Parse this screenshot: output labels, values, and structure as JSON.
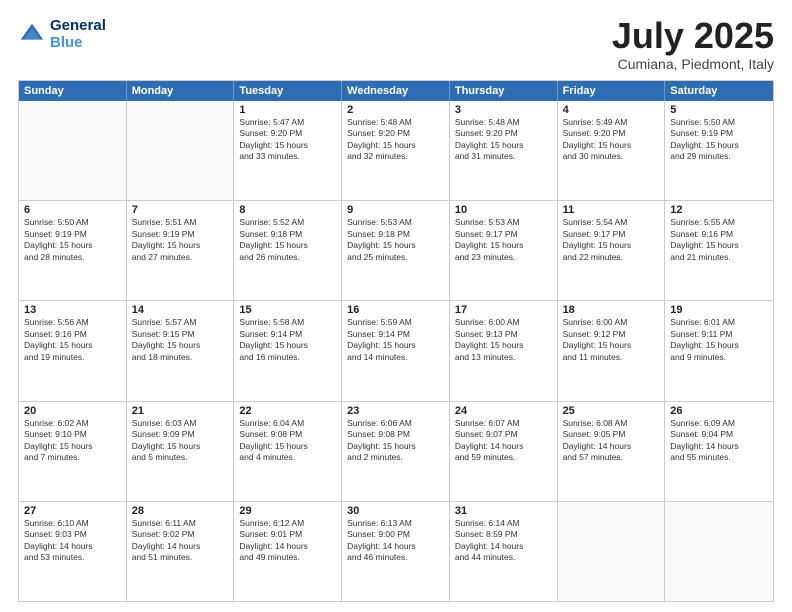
{
  "logo": {
    "line1": "General",
    "line2": "Blue"
  },
  "title": "July 2025",
  "subtitle": "Cumiana, Piedmont, Italy",
  "header_days": [
    "Sunday",
    "Monday",
    "Tuesday",
    "Wednesday",
    "Thursday",
    "Friday",
    "Saturday"
  ],
  "rows": [
    [
      {
        "day": "",
        "info": ""
      },
      {
        "day": "",
        "info": ""
      },
      {
        "day": "1",
        "info": "Sunrise: 5:47 AM\nSunset: 9:20 PM\nDaylight: 15 hours\nand 33 minutes."
      },
      {
        "day": "2",
        "info": "Sunrise: 5:48 AM\nSunset: 9:20 PM\nDaylight: 15 hours\nand 32 minutes."
      },
      {
        "day": "3",
        "info": "Sunrise: 5:48 AM\nSunset: 9:20 PM\nDaylight: 15 hours\nand 31 minutes."
      },
      {
        "day": "4",
        "info": "Sunrise: 5:49 AM\nSunset: 9:20 PM\nDaylight: 15 hours\nand 30 minutes."
      },
      {
        "day": "5",
        "info": "Sunrise: 5:50 AM\nSunset: 9:19 PM\nDaylight: 15 hours\nand 29 minutes."
      }
    ],
    [
      {
        "day": "6",
        "info": "Sunrise: 5:50 AM\nSunset: 9:19 PM\nDaylight: 15 hours\nand 28 minutes."
      },
      {
        "day": "7",
        "info": "Sunrise: 5:51 AM\nSunset: 9:19 PM\nDaylight: 15 hours\nand 27 minutes."
      },
      {
        "day": "8",
        "info": "Sunrise: 5:52 AM\nSunset: 9:18 PM\nDaylight: 15 hours\nand 26 minutes."
      },
      {
        "day": "9",
        "info": "Sunrise: 5:53 AM\nSunset: 9:18 PM\nDaylight: 15 hours\nand 25 minutes."
      },
      {
        "day": "10",
        "info": "Sunrise: 5:53 AM\nSunset: 9:17 PM\nDaylight: 15 hours\nand 23 minutes."
      },
      {
        "day": "11",
        "info": "Sunrise: 5:54 AM\nSunset: 9:17 PM\nDaylight: 15 hours\nand 22 minutes."
      },
      {
        "day": "12",
        "info": "Sunrise: 5:55 AM\nSunset: 9:16 PM\nDaylight: 15 hours\nand 21 minutes."
      }
    ],
    [
      {
        "day": "13",
        "info": "Sunrise: 5:56 AM\nSunset: 9:16 PM\nDaylight: 15 hours\nand 19 minutes."
      },
      {
        "day": "14",
        "info": "Sunrise: 5:57 AM\nSunset: 9:15 PM\nDaylight: 15 hours\nand 18 minutes."
      },
      {
        "day": "15",
        "info": "Sunrise: 5:58 AM\nSunset: 9:14 PM\nDaylight: 15 hours\nand 16 minutes."
      },
      {
        "day": "16",
        "info": "Sunrise: 5:59 AM\nSunset: 9:14 PM\nDaylight: 15 hours\nand 14 minutes."
      },
      {
        "day": "17",
        "info": "Sunrise: 6:00 AM\nSunset: 9:13 PM\nDaylight: 15 hours\nand 13 minutes."
      },
      {
        "day": "18",
        "info": "Sunrise: 6:00 AM\nSunset: 9:12 PM\nDaylight: 15 hours\nand 11 minutes."
      },
      {
        "day": "19",
        "info": "Sunrise: 6:01 AM\nSunset: 9:11 PM\nDaylight: 15 hours\nand 9 minutes."
      }
    ],
    [
      {
        "day": "20",
        "info": "Sunrise: 6:02 AM\nSunset: 9:10 PM\nDaylight: 15 hours\nand 7 minutes."
      },
      {
        "day": "21",
        "info": "Sunrise: 6:03 AM\nSunset: 9:09 PM\nDaylight: 15 hours\nand 5 minutes."
      },
      {
        "day": "22",
        "info": "Sunrise: 6:04 AM\nSunset: 9:08 PM\nDaylight: 15 hours\nand 4 minutes."
      },
      {
        "day": "23",
        "info": "Sunrise: 6:06 AM\nSunset: 9:08 PM\nDaylight: 15 hours\nand 2 minutes."
      },
      {
        "day": "24",
        "info": "Sunrise: 6:07 AM\nSunset: 9:07 PM\nDaylight: 14 hours\nand 59 minutes."
      },
      {
        "day": "25",
        "info": "Sunrise: 6:08 AM\nSunset: 9:05 PM\nDaylight: 14 hours\nand 57 minutes."
      },
      {
        "day": "26",
        "info": "Sunrise: 6:09 AM\nSunset: 9:04 PM\nDaylight: 14 hours\nand 55 minutes."
      }
    ],
    [
      {
        "day": "27",
        "info": "Sunrise: 6:10 AM\nSunset: 9:03 PM\nDaylight: 14 hours\nand 53 minutes."
      },
      {
        "day": "28",
        "info": "Sunrise: 6:11 AM\nSunset: 9:02 PM\nDaylight: 14 hours\nand 51 minutes."
      },
      {
        "day": "29",
        "info": "Sunrise: 6:12 AM\nSunset: 9:01 PM\nDaylight: 14 hours\nand 49 minutes."
      },
      {
        "day": "30",
        "info": "Sunrise: 6:13 AM\nSunset: 9:00 PM\nDaylight: 14 hours\nand 46 minutes."
      },
      {
        "day": "31",
        "info": "Sunrise: 6:14 AM\nSunset: 8:59 PM\nDaylight: 14 hours\nand 44 minutes."
      },
      {
        "day": "",
        "info": ""
      },
      {
        "day": "",
        "info": ""
      }
    ]
  ]
}
